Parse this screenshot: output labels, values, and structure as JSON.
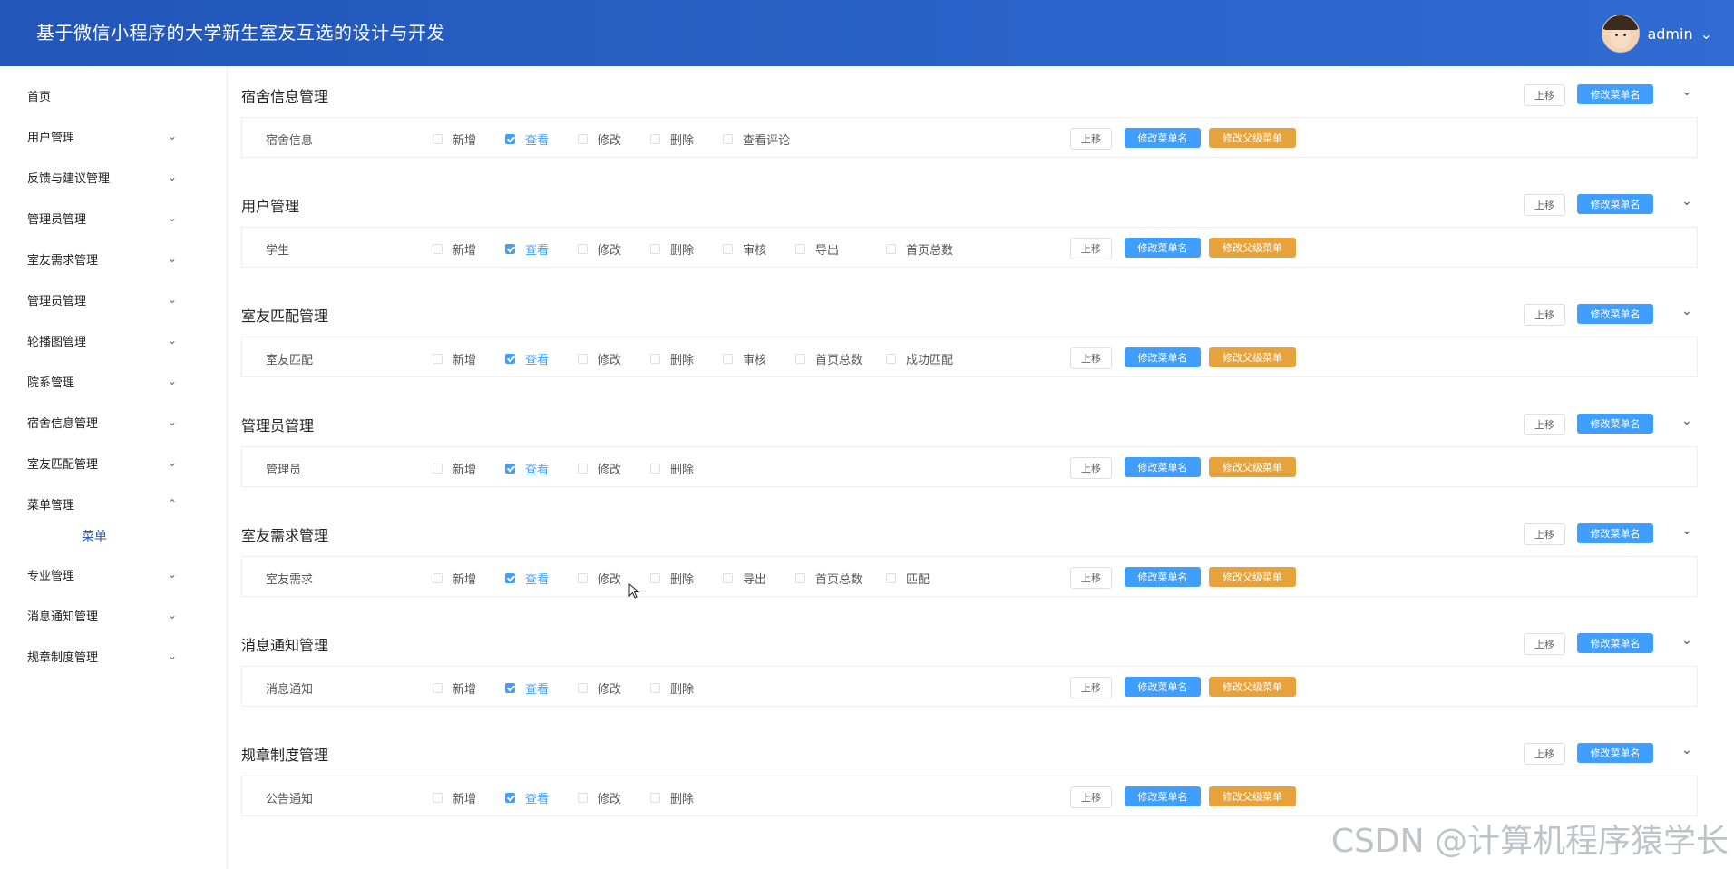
{
  "header": {
    "title": "基于微信小程序的大学新生室友互选的设计与开发",
    "username": "admin",
    "user_dropdown_icon": "chevron-down-icon"
  },
  "sidebar": {
    "items": [
      {
        "label": "首页",
        "expanded": null
      },
      {
        "label": "用户管理",
        "expanded": false
      },
      {
        "label": "反馈与建议管理",
        "expanded": false
      },
      {
        "label": "管理员管理",
        "expanded": false
      },
      {
        "label": "室友需求管理",
        "expanded": false
      },
      {
        "label": "管理员管理",
        "expanded": false
      },
      {
        "label": "轮播图管理",
        "expanded": false
      },
      {
        "label": "院系管理",
        "expanded": false
      },
      {
        "label": "宿舍信息管理",
        "expanded": false
      },
      {
        "label": "室友匹配管理",
        "expanded": false
      },
      {
        "label": "菜单管理",
        "expanded": true,
        "children": [
          "菜单"
        ]
      },
      {
        "label": "专业管理",
        "expanded": false
      },
      {
        "label": "消息通知管理",
        "expanded": false
      },
      {
        "label": "规章制度管理",
        "expanded": false
      }
    ]
  },
  "buttons": {
    "move_up": "上移",
    "rename": "修改菜单名",
    "change_parent": "修改父级菜单"
  },
  "sections": [
    {
      "title": "宿舍信息管理",
      "row": {
        "name": "宿舍信息",
        "perms": [
          {
            "label": "新增",
            "checked": false
          },
          {
            "label": "查看",
            "checked": true
          },
          {
            "label": "修改",
            "checked": false
          },
          {
            "label": "删除",
            "checked": false
          },
          {
            "label": "查看评论",
            "checked": false
          }
        ]
      }
    },
    {
      "title": "用户管理",
      "row": {
        "name": "学生",
        "perms": [
          {
            "label": "新增",
            "checked": false
          },
          {
            "label": "查看",
            "checked": true
          },
          {
            "label": "修改",
            "checked": false
          },
          {
            "label": "删除",
            "checked": false
          },
          {
            "label": "审核",
            "checked": false
          },
          {
            "label": "导出",
            "checked": false
          },
          {
            "label": "首页总数",
            "checked": false
          }
        ]
      }
    },
    {
      "title": "室友匹配管理",
      "row": {
        "name": "室友匹配",
        "perms": [
          {
            "label": "新增",
            "checked": false
          },
          {
            "label": "查看",
            "checked": true
          },
          {
            "label": "修改",
            "checked": false
          },
          {
            "label": "删除",
            "checked": false
          },
          {
            "label": "审核",
            "checked": false
          },
          {
            "label": "首页总数",
            "checked": false
          },
          {
            "label": "成功匹配",
            "checked": false
          }
        ]
      }
    },
    {
      "title": "管理员管理",
      "row": {
        "name": "管理员",
        "perms": [
          {
            "label": "新增",
            "checked": false
          },
          {
            "label": "查看",
            "checked": true
          },
          {
            "label": "修改",
            "checked": false
          },
          {
            "label": "删除",
            "checked": false
          }
        ]
      }
    },
    {
      "title": "室友需求管理",
      "row": {
        "name": "室友需求",
        "perms": [
          {
            "label": "新增",
            "checked": false
          },
          {
            "label": "查看",
            "checked": true
          },
          {
            "label": "修改",
            "checked": false
          },
          {
            "label": "删除",
            "checked": false
          },
          {
            "label": "导出",
            "checked": false
          },
          {
            "label": "首页总数",
            "checked": false
          },
          {
            "label": "匹配",
            "checked": false
          }
        ]
      }
    },
    {
      "title": "消息通知管理",
      "row": {
        "name": "消息通知",
        "perms": [
          {
            "label": "新增",
            "checked": false
          },
          {
            "label": "查看",
            "checked": true
          },
          {
            "label": "修改",
            "checked": false
          },
          {
            "label": "删除",
            "checked": false
          }
        ]
      }
    },
    {
      "title": "规章制度管理",
      "row": {
        "name": "公告通知",
        "perms": [
          {
            "label": "新增",
            "checked": false
          },
          {
            "label": "查看",
            "checked": true
          },
          {
            "label": "修改",
            "checked": false
          },
          {
            "label": "删除",
            "checked": false
          }
        ]
      }
    }
  ],
  "colors": {
    "primary": "#409eff",
    "warning": "#e6a23c",
    "header": "#2a63c9"
  },
  "watermark": "CSDN @计算机程序猿学长"
}
